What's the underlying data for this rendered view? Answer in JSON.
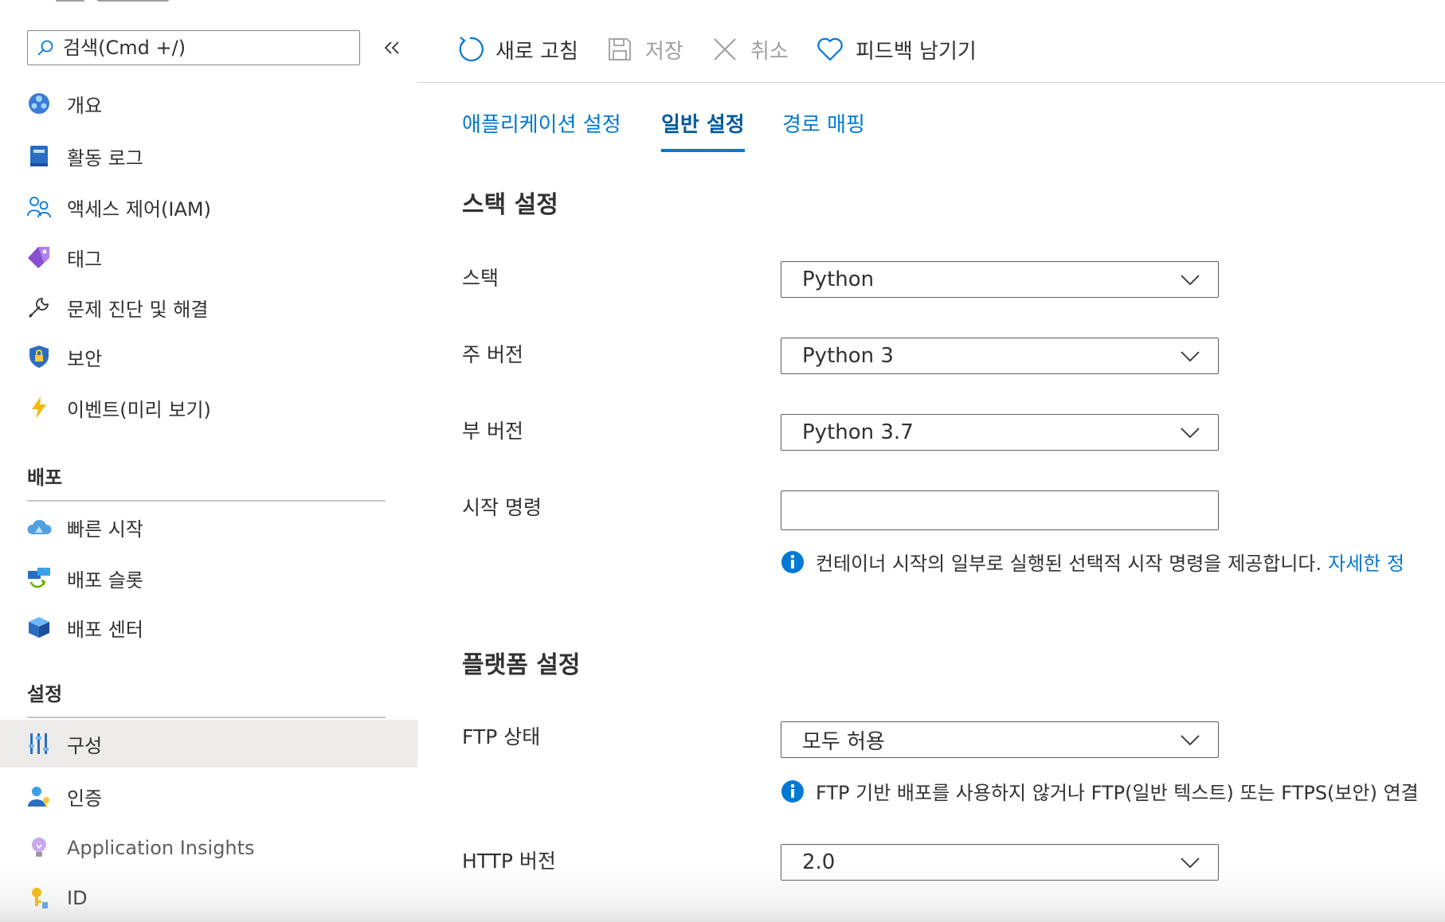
{
  "sidebar": {
    "search": {
      "placeholder": "검색(Cmd +/)",
      "value": ""
    },
    "items": [
      {
        "label": "개요",
        "icon": "overview-icon"
      },
      {
        "label": "활동 로그",
        "icon": "activity-log-icon"
      },
      {
        "label": "액세스 제어(IAM)",
        "icon": "people-icon"
      },
      {
        "label": "태그",
        "icon": "tag-icon"
      },
      {
        "label": "문제 진단 및 해결",
        "icon": "wrench-icon"
      },
      {
        "label": "보안",
        "icon": "shield-icon"
      },
      {
        "label": "이벤트(미리 보기)",
        "icon": "lightning-icon"
      }
    ],
    "sections": [
      {
        "title": "배포",
        "items": [
          {
            "label": "빠른 시작",
            "icon": "cloud-quickstart-icon"
          },
          {
            "label": "배포 슬롯",
            "icon": "deployment-slots-icon"
          },
          {
            "label": "배포 센터",
            "icon": "cube-icon"
          }
        ]
      },
      {
        "title": "설정",
        "items": [
          {
            "label": "구성",
            "icon": "sliders-icon",
            "selected": true
          },
          {
            "label": "인증",
            "icon": "person-key-icon"
          },
          {
            "label": "Application Insights",
            "icon": "lightbulb-icon"
          },
          {
            "label": "ID",
            "icon": "key-icon"
          }
        ]
      }
    ]
  },
  "toolbar": {
    "refresh": "새로 고침",
    "save": "저장",
    "discard": "취소",
    "feedback": "피드백 남기기"
  },
  "tabs": [
    {
      "label": "애플리케이션 설정",
      "active": false
    },
    {
      "label": "일반 설정",
      "active": true
    },
    {
      "label": "경로 매핑",
      "active": false
    }
  ],
  "stack_settings": {
    "title": "스택 설정",
    "stack": {
      "label": "스택",
      "value": "Python"
    },
    "major_version": {
      "label": "주 버전",
      "value": "Python 3"
    },
    "minor_version": {
      "label": "부 버전",
      "value": "Python 3.7"
    },
    "startup_command": {
      "label": "시작 명령",
      "value": "",
      "info": "컨테이너 시작의 일부로 실행된 선택적 시작 명령을 제공합니다.",
      "link": "자세한 정"
    }
  },
  "platform_settings": {
    "title": "플랫폼 설정",
    "ftp_state": {
      "label": "FTP 상태",
      "value": "모두 허용",
      "info": "FTP 기반 배포를 사용하지 않거나 FTP(일반 텍스트) 또는 FTPS(보안) 연결"
    },
    "http_version": {
      "label": "HTTP 버전",
      "value": "2.0"
    }
  },
  "colors": {
    "accent": "#0078d4",
    "selected_bg": "#edebe9",
    "text": "#323130",
    "disabled": "#a19f9d"
  }
}
